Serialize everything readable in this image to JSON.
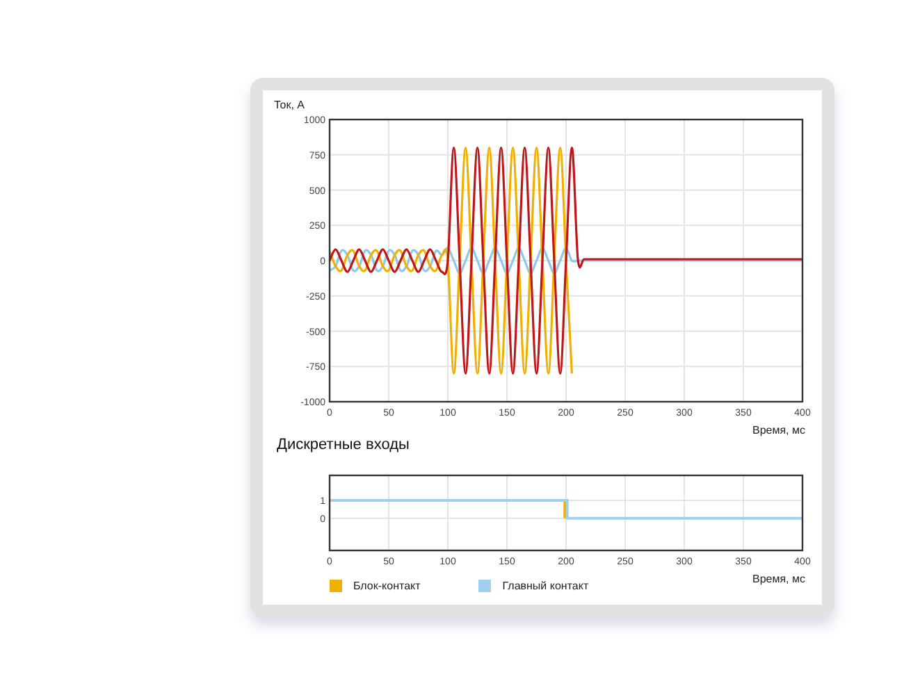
{
  "current_chart": {
    "chart_data": {
      "type": "line",
      "ylabel": "Ток, А",
      "xlabel": "Время, мс",
      "grid": true,
      "xlim": [
        0,
        400
      ],
      "ylim": [
        -1000,
        1000
      ],
      "xticks": [
        0,
        50,
        100,
        150,
        200,
        250,
        300,
        350,
        400
      ],
      "yticks": [
        -1000,
        -750,
        -500,
        -250,
        0,
        250,
        500,
        750,
        1000
      ],
      "x": [
        0,
        5,
        10,
        15,
        20,
        25,
        30,
        35,
        40,
        45,
        50,
        55,
        60,
        65,
        70,
        75,
        80,
        85,
        90,
        95,
        100,
        105,
        110,
        115,
        120,
        125,
        130,
        135,
        140,
        145,
        150,
        155,
        160,
        165,
        170,
        175,
        180,
        185,
        190,
        195,
        200,
        205,
        210,
        215,
        220,
        225,
        230,
        235,
        240,
        245,
        250,
        255,
        260,
        265,
        270,
        275,
        280,
        285,
        290,
        295,
        300,
        305,
        310,
        315,
        320,
        325,
        330,
        335,
        340,
        345,
        350,
        355,
        360,
        365,
        370,
        375,
        380,
        385,
        390,
        395,
        400
      ],
      "series": [
        {
          "color": "#8ec8ec",
          "values": [
            -70,
            -40,
            70,
            40,
            -70,
            -40,
            70,
            40,
            -70,
            -40,
            70,
            40,
            -70,
            -40,
            70,
            40,
            -70,
            -40,
            70,
            40,
            90,
            0,
            -90,
            0,
            90,
            0,
            -90,
            0,
            90,
            0,
            -90,
            0,
            90,
            0,
            -90,
            0,
            90,
            0,
            -90,
            0,
            90,
            0,
            0,
            0,
            0,
            0,
            0,
            0,
            0,
            0,
            0,
            0,
            0,
            0,
            0,
            0,
            0,
            0,
            0,
            0,
            0,
            0,
            0,
            0,
            0,
            0,
            0,
            0,
            0,
            0,
            0,
            0,
            0,
            0,
            0,
            0,
            0,
            0,
            0,
            0,
            0
          ]
        },
        {
          "color": "#f0b000",
          "values": [
            70,
            -40,
            -70,
            40,
            70,
            -40,
            -70,
            40,
            70,
            -40,
            -70,
            40,
            70,
            -40,
            -70,
            40,
            70,
            -40,
            -70,
            40,
            0,
            -800,
            0,
            800,
            0,
            -800,
            0,
            800,
            0,
            -800,
            0,
            800,
            0,
            -800,
            0,
            800,
            0,
            -800,
            0,
            800,
            0,
            -800,
            null,
            null,
            null,
            null,
            null,
            null,
            null,
            null,
            null,
            null,
            null,
            null,
            null,
            null,
            null,
            null,
            null,
            null,
            null,
            null,
            null,
            null,
            null,
            null,
            null,
            null,
            null,
            null,
            null,
            null,
            null,
            null,
            null,
            null,
            null,
            null,
            null,
            null,
            null
          ]
        },
        {
          "color": "#c0161a",
          "values": [
            0,
            80,
            0,
            -80,
            0,
            80,
            0,
            -80,
            0,
            80,
            0,
            -80,
            0,
            80,
            0,
            -80,
            0,
            80,
            0,
            -80,
            0,
            800,
            0,
            -800,
            0,
            800,
            0,
            -800,
            0,
            800,
            0,
            -800,
            0,
            800,
            0,
            -800,
            0,
            800,
            0,
            -800,
            0,
            800,
            10,
            10,
            10,
            10,
            10,
            10,
            10,
            10,
            10,
            10,
            10,
            10,
            10,
            10,
            10,
            10,
            10,
            10,
            10,
            10,
            10,
            10,
            10,
            10,
            10,
            10,
            10,
            10,
            10,
            10,
            10,
            10,
            10,
            10,
            10,
            10,
            10,
            10,
            10
          ]
        }
      ]
    }
  },
  "discrete_inputs": {
    "title": "Дискретные входы",
    "chart_data": {
      "type": "line",
      "xlabel": "Время, мс",
      "grid": true,
      "xlim": [
        0,
        400
      ],
      "ylim": [
        -1.8,
        2.4
      ],
      "xticks": [
        0,
        50,
        100,
        150,
        200,
        250,
        300,
        350,
        400
      ],
      "yticks": [
        0,
        1
      ],
      "x": [
        0,
        199,
        199,
        201,
        201,
        400
      ],
      "series": [
        {
          "name": "Блок-контакт",
          "color": "#f0b000",
          "values": [
            null,
            1,
            0,
            null,
            null,
            null
          ]
        },
        {
          "name": "Главный контакт",
          "color": "#9fd0f2",
          "values": [
            1,
            1,
            1,
            1,
            0,
            0
          ]
        }
      ]
    }
  }
}
